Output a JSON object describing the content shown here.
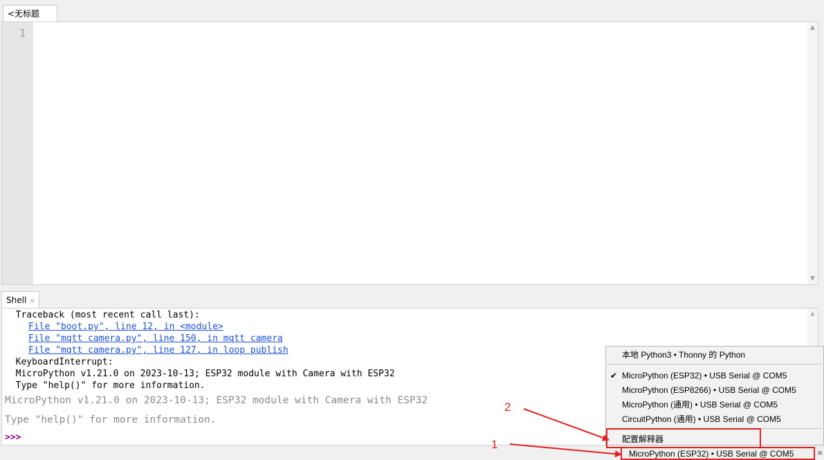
{
  "editor": {
    "tab_label": "<无标题>",
    "tab_close": "×",
    "line_numbers": [
      "1"
    ]
  },
  "shell": {
    "tab_label": "Shell",
    "tab_close": "×",
    "lines": [
      {
        "text": "  Traceback (most recent call last):",
        "style": "normal"
      },
      {
        "text": "File \"boot.py\", line 12, in <module>",
        "style": "link"
      },
      {
        "text": "File \"mqtt camera.py\", line 150, in mqtt camera",
        "style": "link"
      },
      {
        "text": "File \"mqtt camera.py\", line 127, in loop publish",
        "style": "link"
      },
      {
        "text": "  KeyboardInterrupt:",
        "style": "normal"
      },
      {
        "text": "  MicroPython v1.21.0 on 2023-10-13; ESP32 module with Camera with ESP32",
        "style": "normal"
      },
      {
        "text": "  Type \"help()\" for more information.",
        "style": "normal"
      }
    ],
    "banner_1": "MicroPython v1.21.0 on 2023-10-13; ESP32 module with Camera with ESP32",
    "banner_2": "Type \"help()\" for more information.",
    "prompt": ">>>"
  },
  "interpreter_menu": {
    "items": [
      {
        "label": "本地 Python3  •  Thonny 的 Python",
        "checked": false
      },
      {
        "label": "MicroPython (ESP32)  •  USB Serial @ COM5",
        "checked": true
      },
      {
        "label": "MicroPython (ESP8266)  •  USB Serial @ COM5",
        "checked": false
      },
      {
        "label": "MicroPython (通用)  •  USB Serial @ COM5",
        "checked": false
      },
      {
        "label": "CircuitPython (通用)  •  USB Serial @ COM5",
        "checked": false
      },
      {
        "label": "配置解释器",
        "checked": false
      }
    ],
    "check_mark": "✔"
  },
  "statusbar": {
    "interpreter": "MicroPython (ESP32)  •  USB Serial @ COM5",
    "more": "≡"
  },
  "annotations": {
    "label_1": "1",
    "label_2": "2",
    "color": "#e02020"
  }
}
